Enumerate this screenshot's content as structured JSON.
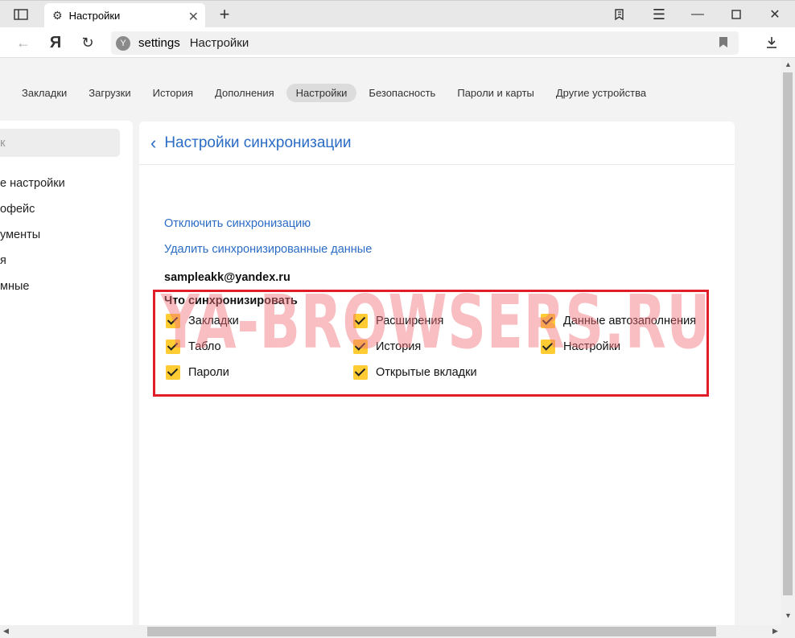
{
  "tab": {
    "title": "Настройки"
  },
  "address": {
    "url": "settings",
    "page_title": "Настройки"
  },
  "topnav": [
    {
      "label": "Закладки",
      "active": false
    },
    {
      "label": "Загрузки",
      "active": false
    },
    {
      "label": "История",
      "active": false
    },
    {
      "label": "Дополнения",
      "active": false
    },
    {
      "label": "Настройки",
      "active": true
    },
    {
      "label": "Безопасность",
      "active": false
    },
    {
      "label": "Пароли и карты",
      "active": false
    },
    {
      "label": "Другие устройства",
      "active": false
    }
  ],
  "sidebar": {
    "search_fragment": "к",
    "items": [
      "е настройки",
      "офейс",
      "ументы",
      "я",
      "мные"
    ]
  },
  "panel": {
    "title": "Настройки синхронизации",
    "disable_link": "Отключить синхронизацию",
    "delete_link": "Удалить синхронизированные данные",
    "email": "sampleakk@yandex.ru",
    "sync_title": "Что синхронизировать",
    "options": [
      {
        "label": "Закладки",
        "checked": true
      },
      {
        "label": "Расширения",
        "checked": true
      },
      {
        "label": "Данные автозаполнения",
        "checked": true
      },
      {
        "label": "Табло",
        "checked": true
      },
      {
        "label": "История",
        "checked": true
      },
      {
        "label": "Настройки",
        "checked": true
      },
      {
        "label": "Пароли",
        "checked": true
      },
      {
        "label": "Открытые вкладки",
        "checked": true
      }
    ]
  },
  "watermark": "YA-BROWSERS.RU",
  "colors": {
    "link": "#2b6cc4",
    "checkbox": "#ffcc33",
    "highlight": "#e11d2a"
  }
}
